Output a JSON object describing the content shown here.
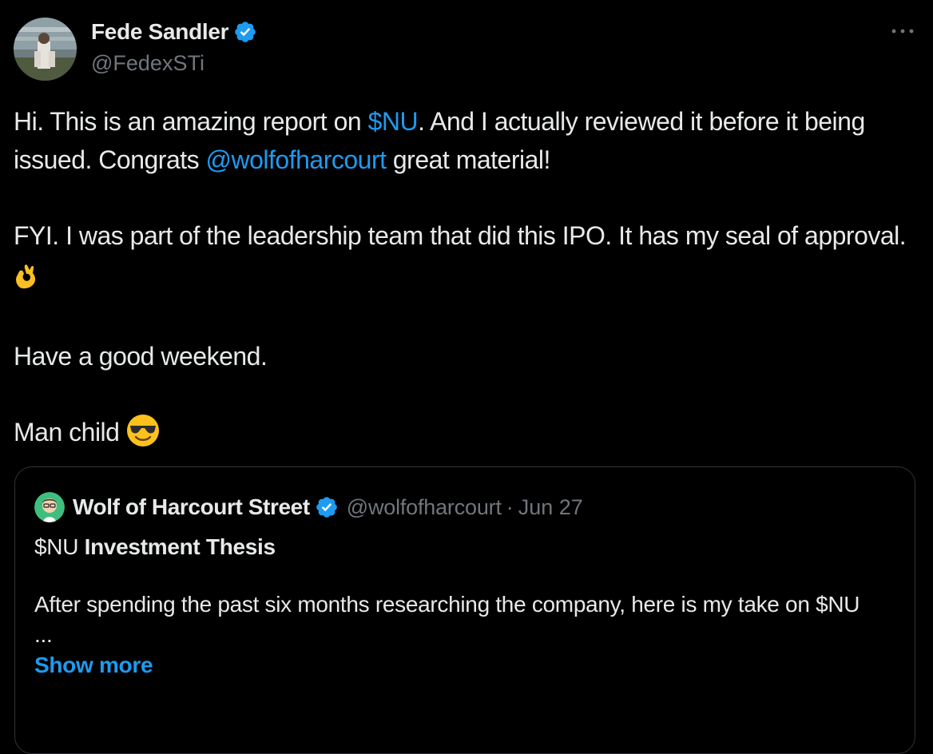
{
  "author": {
    "display_name": "Fede Sandler",
    "handle": "@FedexSTi",
    "verified": true
  },
  "tweet": {
    "line1_a": "Hi. This is an amazing report on ",
    "cashtag": "$NU",
    "line1_b": ". And I actually reviewed it before it being issued. Congrats ",
    "mention": "@wolfofharcourt",
    "line1_c": " great material!",
    "para2": "FYI. I was part of the leadership team that did this IPO. It has my seal of approval.",
    "para2_emoji": "ok-hand-emoji",
    "para3": "Have a good weekend.",
    "para4": "Man child",
    "para4_emoji": "sunglasses-emoji"
  },
  "quote": {
    "display_name": "Wolf of Harcourt Street",
    "handle": "@wolfofharcourt",
    "separator": "·",
    "date": "Jun 27",
    "title_cashtag": "$NU",
    "title_bold": "Investment Thesis",
    "body": "After spending the past six months researching the company, here is my take on $NU",
    "ellipsis": "...",
    "show_more": "Show more"
  },
  "colors": {
    "background": "#000000",
    "text": "#e7e9ea",
    "muted": "#71767b",
    "link": "#1d9bf0",
    "border": "#2f3336",
    "verified": "#1d9bf0"
  },
  "icons": {
    "more": "more-horizontal-icon",
    "verified": "verified-badge-icon"
  }
}
